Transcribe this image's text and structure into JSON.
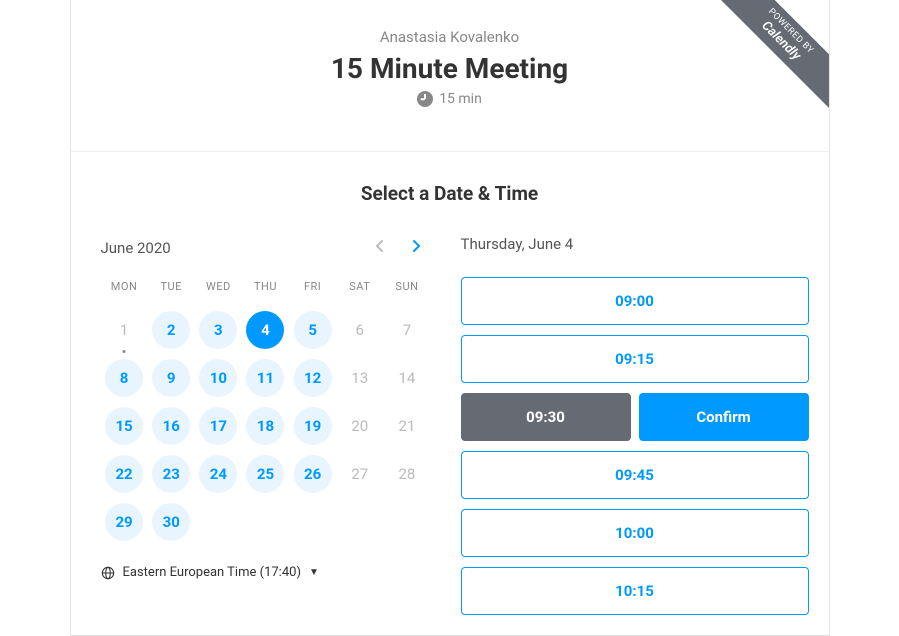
{
  "ribbon": {
    "small": "POWERED BY",
    "big": "Calendly"
  },
  "host": "Anastasia Kovalenko",
  "title": "15 Minute Meeting",
  "duration": "15 min",
  "subtitle": "Select a Date & Time",
  "calendar": {
    "month_label": "June 2020",
    "dow": [
      "MON",
      "TUE",
      "WED",
      "THU",
      "FRI",
      "SAT",
      "SUN"
    ],
    "days": [
      {
        "n": "1",
        "state": "unavail",
        "today": true
      },
      {
        "n": "2",
        "state": "avail"
      },
      {
        "n": "3",
        "state": "avail"
      },
      {
        "n": "4",
        "state": "selected"
      },
      {
        "n": "5",
        "state": "avail"
      },
      {
        "n": "6",
        "state": "unavail"
      },
      {
        "n": "7",
        "state": "unavail"
      },
      {
        "n": "8",
        "state": "avail"
      },
      {
        "n": "9",
        "state": "avail"
      },
      {
        "n": "10",
        "state": "avail"
      },
      {
        "n": "11",
        "state": "avail"
      },
      {
        "n": "12",
        "state": "avail"
      },
      {
        "n": "13",
        "state": "unavail"
      },
      {
        "n": "14",
        "state": "unavail"
      },
      {
        "n": "15",
        "state": "avail"
      },
      {
        "n": "16",
        "state": "avail"
      },
      {
        "n": "17",
        "state": "avail"
      },
      {
        "n": "18",
        "state": "avail"
      },
      {
        "n": "19",
        "state": "avail"
      },
      {
        "n": "20",
        "state": "unavail"
      },
      {
        "n": "21",
        "state": "unavail"
      },
      {
        "n": "22",
        "state": "avail"
      },
      {
        "n": "23",
        "state": "avail"
      },
      {
        "n": "24",
        "state": "avail"
      },
      {
        "n": "25",
        "state": "avail"
      },
      {
        "n": "26",
        "state": "avail"
      },
      {
        "n": "27",
        "state": "unavail"
      },
      {
        "n": "28",
        "state": "unavail"
      },
      {
        "n": "29",
        "state": "avail"
      },
      {
        "n": "30",
        "state": "avail"
      }
    ]
  },
  "timezone": "Eastern European Time (17:40)",
  "selected_date_label": "Thursday, June 4",
  "confirm_label": "Confirm",
  "slots": [
    {
      "time": "09:00",
      "picked": false
    },
    {
      "time": "09:15",
      "picked": false
    },
    {
      "time": "09:30",
      "picked": true
    },
    {
      "time": "09:45",
      "picked": false
    },
    {
      "time": "10:00",
      "picked": false
    },
    {
      "time": "10:15",
      "picked": false
    }
  ]
}
